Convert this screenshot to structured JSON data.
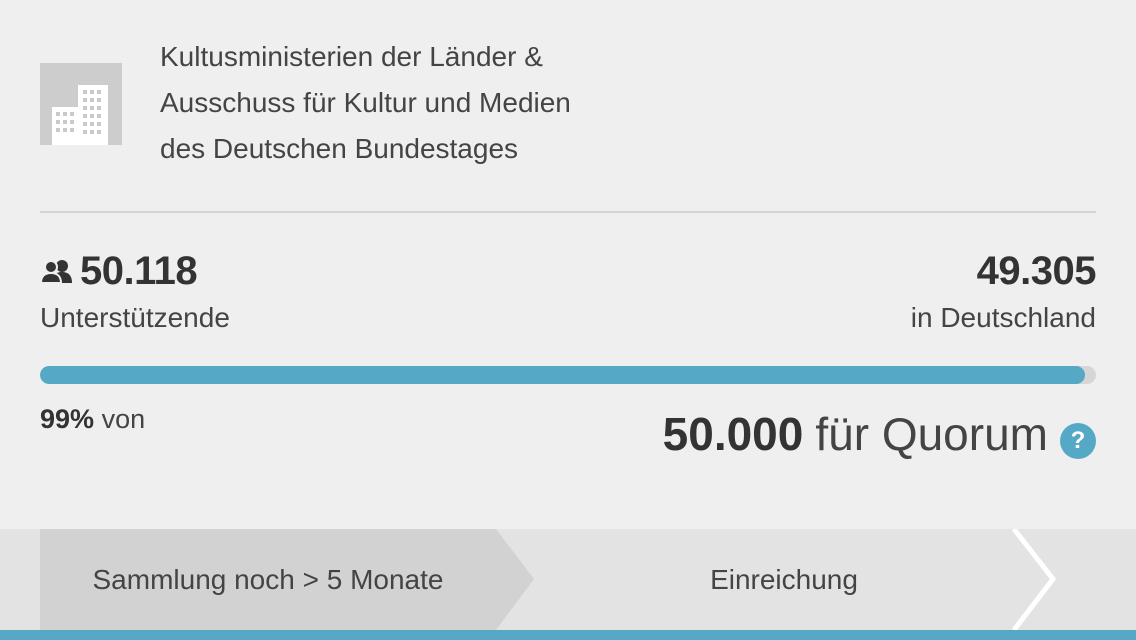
{
  "recipient": {
    "icon": "office-buildings-icon",
    "lines": [
      "Kultusministerien der Länder &",
      "Ausschuss für Kultur und Medien",
      "des Deutschen Bundestages"
    ]
  },
  "stats": {
    "supporters_icon": "people-icon",
    "supporters_count": "50.118",
    "supporters_label": "Unterstützende",
    "germany_count": "49.305",
    "germany_label": "in Deutschland"
  },
  "progress": {
    "fraction": 0.99,
    "percent_label": "99%",
    "of_label": "von",
    "quorum_number": "50.000",
    "quorum_label": "für Quorum",
    "help_icon": "?"
  },
  "steps": [
    {
      "label": "Sammlung noch > 5 Monate",
      "active": true
    },
    {
      "label": "Einreichung",
      "active": false
    }
  ],
  "colors": {
    "accent": "#55a9c6",
    "background": "#efefef",
    "active_step": "#d2d2d2",
    "inactive_step": "#e3e3e3"
  }
}
